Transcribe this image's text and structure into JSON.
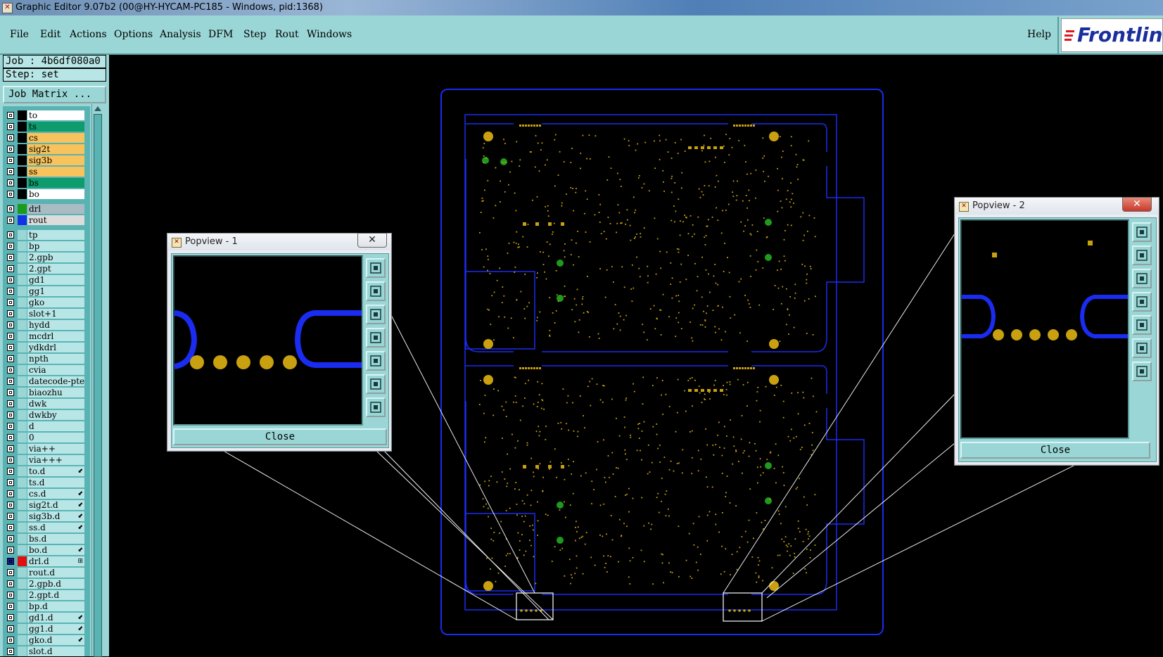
{
  "window": {
    "title": "Graphic Editor 9.07b2 (00@HY-HYCAM-PC185 - Windows, pid:1368)"
  },
  "menu": {
    "items": [
      {
        "label": "File",
        "u": "F",
        "rest": "ile"
      },
      {
        "label": "Edit",
        "u": "E",
        "rest": "dit"
      },
      {
        "label": "Actions",
        "u": "A",
        "rest": "ctions"
      },
      {
        "label": "Options",
        "u": "O",
        "rest": "ptions"
      },
      {
        "label": "Analysis",
        "u": "A",
        "rest": "nalysis"
      },
      {
        "label": "DFM",
        "u": "D",
        "rest": "FM"
      },
      {
        "label": "Step",
        "u": "S",
        "rest": "tep"
      },
      {
        "label": "Rout",
        "u": "R",
        "rest": "out"
      },
      {
        "label": "Windows",
        "u": "W",
        "rest": "indows"
      }
    ],
    "help": "Help",
    "logo": "Frontlin"
  },
  "panel": {
    "job": "Job : 4b6df080a0",
    "step": "Step: set",
    "job_matrix": "Job Matrix ..."
  },
  "layers": [
    {
      "name": "to",
      "color": "#ffffff",
      "swatch": "#000000"
    },
    {
      "name": "ts",
      "color": "#0e9b6e",
      "swatch": "#000000"
    },
    {
      "name": "cs",
      "color": "#f8c25c",
      "swatch": "#000000"
    },
    {
      "name": "sig2t",
      "color": "#f8c25c",
      "swatch": "#000000"
    },
    {
      "name": "sig3b",
      "color": "#f8c25c",
      "swatch": "#000000"
    },
    {
      "name": "ss",
      "color": "#f8c25c",
      "swatch": "#000000"
    },
    {
      "name": "bs",
      "color": "#0e9b6e",
      "swatch": "#000000"
    },
    {
      "name": "bo",
      "color": "#ffffff",
      "swatch": "#000000"
    },
    {
      "name": "drl",
      "color": "#a9bcc4",
      "swatch": "#1b9b1b",
      "gap": true
    },
    {
      "name": "rout",
      "color": "#dcdcdc",
      "swatch": "#1232e6"
    },
    {
      "name": "tp",
      "color": "#b8e6e6",
      "swatch": "#9bd6d6",
      "gap": true
    },
    {
      "name": "bp",
      "color": "#b8e6e6",
      "swatch": "#9bd6d6"
    },
    {
      "name": "2.gpb",
      "color": "#b8e6e6",
      "swatch": "#9bd6d6"
    },
    {
      "name": "2.gpt",
      "color": "#b8e6e6",
      "swatch": "#9bd6d6"
    },
    {
      "name": "gd1",
      "color": "#b8e6e6",
      "swatch": "#9bd6d6"
    },
    {
      "name": "gg1",
      "color": "#b8e6e6",
      "swatch": "#9bd6d6"
    },
    {
      "name": "gko",
      "color": "#b8e6e6",
      "swatch": "#9bd6d6"
    },
    {
      "name": "slot+1",
      "color": "#b8e6e6",
      "swatch": "#9bd6d6"
    },
    {
      "name": "hydd",
      "color": "#b8e6e6",
      "swatch": "#9bd6d6"
    },
    {
      "name": "mcdrl",
      "color": "#b8e6e6",
      "swatch": "#9bd6d6"
    },
    {
      "name": "ydkdrl",
      "color": "#b8e6e6",
      "swatch": "#9bd6d6"
    },
    {
      "name": "npth",
      "color": "#b8e6e6",
      "swatch": "#9bd6d6"
    },
    {
      "name": "cvia",
      "color": "#b8e6e6",
      "swatch": "#9bd6d6"
    },
    {
      "name": "datecode-pte",
      "color": "#b8e6e6",
      "swatch": "#9bd6d6"
    },
    {
      "name": "biaozhu",
      "color": "#b8e6e6",
      "swatch": "#9bd6d6"
    },
    {
      "name": "dwk",
      "color": "#b8e6e6",
      "swatch": "#9bd6d6"
    },
    {
      "name": "dwkby",
      "color": "#b8e6e6",
      "swatch": "#9bd6d6"
    },
    {
      "name": "d",
      "color": "#b8e6e6",
      "swatch": "#9bd6d6"
    },
    {
      "name": "0",
      "color": "#b8e6e6",
      "swatch": "#9bd6d6"
    },
    {
      "name": "via++",
      "color": "#b8e6e6",
      "swatch": "#9bd6d6"
    },
    {
      "name": "via+++",
      "color": "#b8e6e6",
      "swatch": "#9bd6d6"
    },
    {
      "name": "to.d",
      "color": "#b8e6e6",
      "swatch": "#9bd6d6",
      "mark": "⬋"
    },
    {
      "name": "ts.d",
      "color": "#b8e6e6",
      "swatch": "#9bd6d6"
    },
    {
      "name": "cs.d",
      "color": "#b8e6e6",
      "swatch": "#9bd6d6",
      "mark": "⬋"
    },
    {
      "name": "sig2t.d",
      "color": "#b8e6e6",
      "swatch": "#9bd6d6",
      "mark": "⬋"
    },
    {
      "name": "sig3b.d",
      "color": "#b8e6e6",
      "swatch": "#9bd6d6",
      "mark": "⬋"
    },
    {
      "name": "ss.d",
      "color": "#b8e6e6",
      "swatch": "#9bd6d6",
      "mark": "⬋"
    },
    {
      "name": "bs.d",
      "color": "#b8e6e6",
      "swatch": "#9bd6d6"
    },
    {
      "name": "bo.d",
      "color": "#b8e6e6",
      "swatch": "#9bd6d6",
      "mark": "⬋"
    },
    {
      "name": "drl.d",
      "color": "#b8e6e6",
      "swatch": "#e01010",
      "dark": true,
      "mark": "⊞"
    },
    {
      "name": "rout.d",
      "color": "#b8e6e6",
      "swatch": "#9bd6d6"
    },
    {
      "name": "2.gpb.d",
      "color": "#b8e6e6",
      "swatch": "#9bd6d6"
    },
    {
      "name": "2.gpt.d",
      "color": "#b8e6e6",
      "swatch": "#9bd6d6"
    },
    {
      "name": "bp.d",
      "color": "#b8e6e6",
      "swatch": "#9bd6d6"
    },
    {
      "name": "gd1.d",
      "color": "#b8e6e6",
      "swatch": "#9bd6d6",
      "mark": "⬋"
    },
    {
      "name": "gg1.d",
      "color": "#b8e6e6",
      "swatch": "#9bd6d6",
      "mark": "⬋"
    },
    {
      "name": "gko.d",
      "color": "#b8e6e6",
      "swatch": "#9bd6d6",
      "mark": "⬋"
    },
    {
      "name": "slot.d",
      "color": "#b8e6e6",
      "swatch": "#9bd6d6"
    }
  ],
  "popup1": {
    "title": "Popview - 1",
    "close": "Close"
  },
  "popup2": {
    "title": "Popview - 2",
    "close": "Close"
  },
  "colors": {
    "rout": "#1a2cf0",
    "pad": "#c9a010",
    "via": "#1e9b1e",
    "panel": "#9bd6d6"
  }
}
